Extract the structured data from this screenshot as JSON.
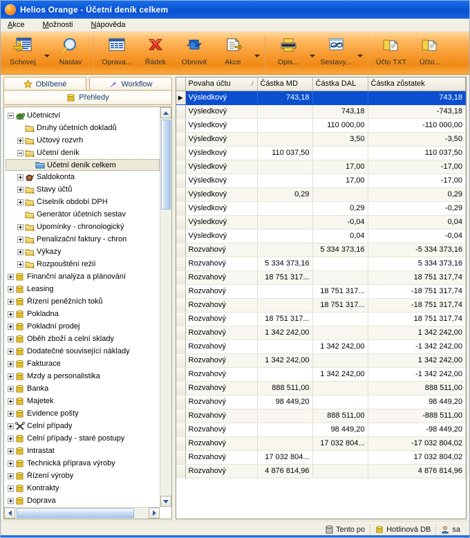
{
  "window": {
    "title_app": "Helios Orange",
    "title_sep": " - ",
    "title_doc": "Účetní deník celkem",
    "app_icon": "orange-sphere-icon"
  },
  "menu": {
    "items": [
      {
        "label": "Akce",
        "accel": "A"
      },
      {
        "label": "Možnosti",
        "accel": "M"
      },
      {
        "label": "Nápověda",
        "accel": "N"
      }
    ]
  },
  "toolbar": {
    "buttons": [
      {
        "label": "Schovej",
        "icon": "hide-columns-icon",
        "dropdown": true
      },
      {
        "label": "Nastav",
        "icon": "magnifier-icon",
        "dropdown": false
      },
      {
        "label": "Oprava...",
        "icon": "edit-table-icon",
        "dropdown": false
      },
      {
        "label": "Řádek",
        "icon": "red-x-icon",
        "dropdown": false
      },
      {
        "label": "Obnovit",
        "icon": "refresh-blue-arrows-icon",
        "dropdown": false
      },
      {
        "label": "Akce",
        "icon": "document-action-icon",
        "dropdown": true
      },
      {
        "label": "Opis...",
        "icon": "printer-icon",
        "dropdown": true
      },
      {
        "label": "Sestavy...",
        "icon": "reports-icon",
        "dropdown": true
      },
      {
        "label": "Účto TXT",
        "icon": "folder-document-icon",
        "dropdown": false
      },
      {
        "label": "Účto...",
        "icon": "folder-document-icon",
        "dropdown": false
      }
    ]
  },
  "sidebar": {
    "tabs": [
      {
        "label": "Oblíbené",
        "icon": "star-icon"
      },
      {
        "label": "Workflow",
        "icon": "workflow-comet-icon"
      }
    ],
    "section_header": {
      "label": "Přehledy",
      "icon": "coins-icon"
    },
    "tree": [
      {
        "label": "Účetnictví",
        "depth": 0,
        "toggle": "minus",
        "icon": "turtle-icon",
        "selected": false
      },
      {
        "label": "Druhy účetních dokladů",
        "depth": 1,
        "toggle": "none",
        "icon": "folder-icon",
        "selected": false
      },
      {
        "label": "Účtový rozvrh",
        "depth": 1,
        "toggle": "plus",
        "icon": "folder-icon",
        "selected": false
      },
      {
        "label": "Účetní deník",
        "depth": 1,
        "toggle": "minus",
        "icon": "folder-icon",
        "selected": false
      },
      {
        "label": "Účetní deník celkem",
        "depth": 2,
        "toggle": "none",
        "icon": "blue-folder-icon",
        "selected": true
      },
      {
        "label": "Saldokonta",
        "depth": 1,
        "toggle": "plus",
        "icon": "snail-icon",
        "selected": false
      },
      {
        "label": "Stavy účtů",
        "depth": 1,
        "toggle": "plus",
        "icon": "folder-icon",
        "selected": false
      },
      {
        "label": "Číselník období DPH",
        "depth": 1,
        "toggle": "plus",
        "icon": "folder-icon",
        "selected": false
      },
      {
        "label": "Generátor účetních sestav",
        "depth": 1,
        "toggle": "none",
        "icon": "folder-icon",
        "selected": false
      },
      {
        "label": "Upomínky - chronologický",
        "depth": 1,
        "toggle": "plus",
        "icon": "folder-icon",
        "selected": false
      },
      {
        "label": "Penalizační faktury - chron",
        "depth": 1,
        "toggle": "plus",
        "icon": "folder-icon",
        "selected": false
      },
      {
        "label": "Výkazy",
        "depth": 1,
        "toggle": "plus",
        "icon": "folder-icon",
        "selected": false
      },
      {
        "label": "Rozpouštění režií",
        "depth": 1,
        "toggle": "plus",
        "icon": "folder-icon",
        "selected": false
      },
      {
        "label": "Finanční analýza a plánování",
        "depth": 0,
        "toggle": "plus",
        "icon": "coins-icon",
        "selected": false
      },
      {
        "label": "Leasing",
        "depth": 0,
        "toggle": "plus",
        "icon": "coins-icon",
        "selected": false
      },
      {
        "label": "Řízení peněžních toků",
        "depth": 0,
        "toggle": "plus",
        "icon": "coins-icon",
        "selected": false
      },
      {
        "label": "Pokladna",
        "depth": 0,
        "toggle": "plus",
        "icon": "coins-icon",
        "selected": false
      },
      {
        "label": "Pokladní prodej",
        "depth": 0,
        "toggle": "plus",
        "icon": "coins-icon",
        "selected": false
      },
      {
        "label": "Oběh zboží a celní sklady",
        "depth": 0,
        "toggle": "plus",
        "icon": "coins-icon",
        "selected": false
      },
      {
        "label": "Dodatečné související náklady",
        "depth": 0,
        "toggle": "plus",
        "icon": "coins-icon",
        "selected": false
      },
      {
        "label": "Fakturace",
        "depth": 0,
        "toggle": "plus",
        "icon": "coins-icon",
        "selected": false
      },
      {
        "label": "Mzdy a personalistika",
        "depth": 0,
        "toggle": "plus",
        "icon": "coins-icon",
        "selected": false
      },
      {
        "label": "Banka",
        "depth": 0,
        "toggle": "plus",
        "icon": "coins-icon",
        "selected": false
      },
      {
        "label": "Majetek",
        "depth": 0,
        "toggle": "plus",
        "icon": "coins-icon",
        "selected": false
      },
      {
        "label": "Evidence pošty",
        "depth": 0,
        "toggle": "plus",
        "icon": "coins-icon",
        "selected": false
      },
      {
        "label": "Celní případy",
        "depth": 0,
        "toggle": "plus",
        "icon": "customs-icon",
        "selected": false
      },
      {
        "label": "Celní případy - staré postupy",
        "depth": 0,
        "toggle": "plus",
        "icon": "coins-icon",
        "selected": false
      },
      {
        "label": "Intrastat",
        "depth": 0,
        "toggle": "plus",
        "icon": "coins-icon",
        "selected": false
      },
      {
        "label": "Technická příprava výroby",
        "depth": 0,
        "toggle": "plus",
        "icon": "coins-icon",
        "selected": false
      },
      {
        "label": "Řízení výroby",
        "depth": 0,
        "toggle": "plus",
        "icon": "coins-icon",
        "selected": false
      },
      {
        "label": "Kontrakty",
        "depth": 0,
        "toggle": "plus",
        "icon": "coins-icon",
        "selected": false
      },
      {
        "label": "Doprava",
        "depth": 0,
        "toggle": "plus",
        "icon": "coins-icon",
        "selected": false
      }
    ]
  },
  "grid": {
    "columns": [
      {
        "label": "Povaha účtu",
        "align": "left",
        "sorted": true,
        "sort_glyph": "/"
      },
      {
        "label": "Částka MD",
        "align": "right",
        "sorted": false
      },
      {
        "label": "Částka DAL",
        "align": "right",
        "sorted": false
      },
      {
        "label": "Částka zůstatek",
        "align": "right",
        "sorted": false
      }
    ],
    "rows": [
      {
        "povaha": "Výsledkový",
        "md": "743,18",
        "dal": "",
        "zustatek": "743,18",
        "selected": true
      },
      {
        "povaha": "Výsledkový",
        "md": "",
        "dal": "743,18",
        "zustatek": "-743,18",
        "selected": false
      },
      {
        "povaha": "Výsledkový",
        "md": "",
        "dal": "110 000,00",
        "zustatek": "-110 000,00",
        "selected": false
      },
      {
        "povaha": "Výsledkový",
        "md": "",
        "dal": "3,50",
        "zustatek": "-3,50",
        "selected": false
      },
      {
        "povaha": "Výsledkový",
        "md": "110 037,50",
        "dal": "",
        "zustatek": "110 037,50",
        "selected": false
      },
      {
        "povaha": "Výsledkový",
        "md": "",
        "dal": "17,00",
        "zustatek": "-17,00",
        "selected": false
      },
      {
        "povaha": "Výsledkový",
        "md": "",
        "dal": "17,00",
        "zustatek": "-17,00",
        "selected": false
      },
      {
        "povaha": "Výsledkový",
        "md": "0,29",
        "dal": "",
        "zustatek": "0,29",
        "selected": false
      },
      {
        "povaha": "Výsledkový",
        "md": "",
        "dal": "0,29",
        "zustatek": "-0,29",
        "selected": false
      },
      {
        "povaha": "Výsledkový",
        "md": "",
        "dal": "-0,04",
        "zustatek": "0,04",
        "selected": false
      },
      {
        "povaha": "Výsledkový",
        "md": "",
        "dal": "0,04",
        "zustatek": "-0,04",
        "selected": false
      },
      {
        "povaha": "Rozvahový",
        "md": "",
        "dal": "5 334 373,16",
        "zustatek": "-5 334 373,16",
        "selected": false
      },
      {
        "povaha": "Rozvahový",
        "md": "5 334 373,16",
        "dal": "",
        "zustatek": "5 334 373,16",
        "selected": false
      },
      {
        "povaha": "Rozvahový",
        "md": "18 751 317...",
        "dal": "",
        "zustatek": "18 751 317,74",
        "selected": false
      },
      {
        "povaha": "Rozvahový",
        "md": "",
        "dal": "18 751 317...",
        "zustatek": "-18 751 317,74",
        "selected": false
      },
      {
        "povaha": "Rozvahový",
        "md": "",
        "dal": "18 751 317...",
        "zustatek": "-18 751 317,74",
        "selected": false
      },
      {
        "povaha": "Rozvahový",
        "md": "18 751 317...",
        "dal": "",
        "zustatek": "18 751 317,74",
        "selected": false
      },
      {
        "povaha": "Rozvahový",
        "md": "1 342 242,00",
        "dal": "",
        "zustatek": "1 342 242,00",
        "selected": false
      },
      {
        "povaha": "Rozvahový",
        "md": "",
        "dal": "1 342 242,00",
        "zustatek": "-1 342 242,00",
        "selected": false
      },
      {
        "povaha": "Rozvahový",
        "md": "1 342 242,00",
        "dal": "",
        "zustatek": "1 342 242,00",
        "selected": false
      },
      {
        "povaha": "Rozvahový",
        "md": "",
        "dal": "1 342 242,00",
        "zustatek": "-1 342 242,00",
        "selected": false
      },
      {
        "povaha": "Rozvahový",
        "md": "888 511,00",
        "dal": "",
        "zustatek": "888 511,00",
        "selected": false
      },
      {
        "povaha": "Rozvahový",
        "md": "98 449,20",
        "dal": "",
        "zustatek": "98 449,20",
        "selected": false
      },
      {
        "povaha": "Rozvahový",
        "md": "",
        "dal": "888 511,00",
        "zustatek": "-888 511,00",
        "selected": false
      },
      {
        "povaha": "Rozvahový",
        "md": "",
        "dal": "98 449,20",
        "zustatek": "-98 449,20",
        "selected": false
      },
      {
        "povaha": "Rozvahový",
        "md": "",
        "dal": "17 032 804...",
        "zustatek": "-17 032 804,02",
        "selected": false
      },
      {
        "povaha": "Rozvahový",
        "md": "17 032 804...",
        "dal": "",
        "zustatek": "17 032 804,02",
        "selected": false
      },
      {
        "povaha": "Rozvahový",
        "md": "4 876 814,96",
        "dal": "",
        "zustatek": "4 876 814,96",
        "selected": false
      }
    ]
  },
  "statusbar": {
    "cells": [
      {
        "label": "Tento po",
        "icon": "database-icon"
      },
      {
        "label": "Hotlinová DB",
        "icon": "coins-icon"
      },
      {
        "label": "sa",
        "icon": "user-icon"
      }
    ]
  },
  "colors": {
    "title_blue": "#0a56d8",
    "toolbar_orange": "#f79a30",
    "selection_blue": "#0a4fd0",
    "row_alt": "#f7f6ef",
    "accent_bottom": "#1f6fe0"
  }
}
